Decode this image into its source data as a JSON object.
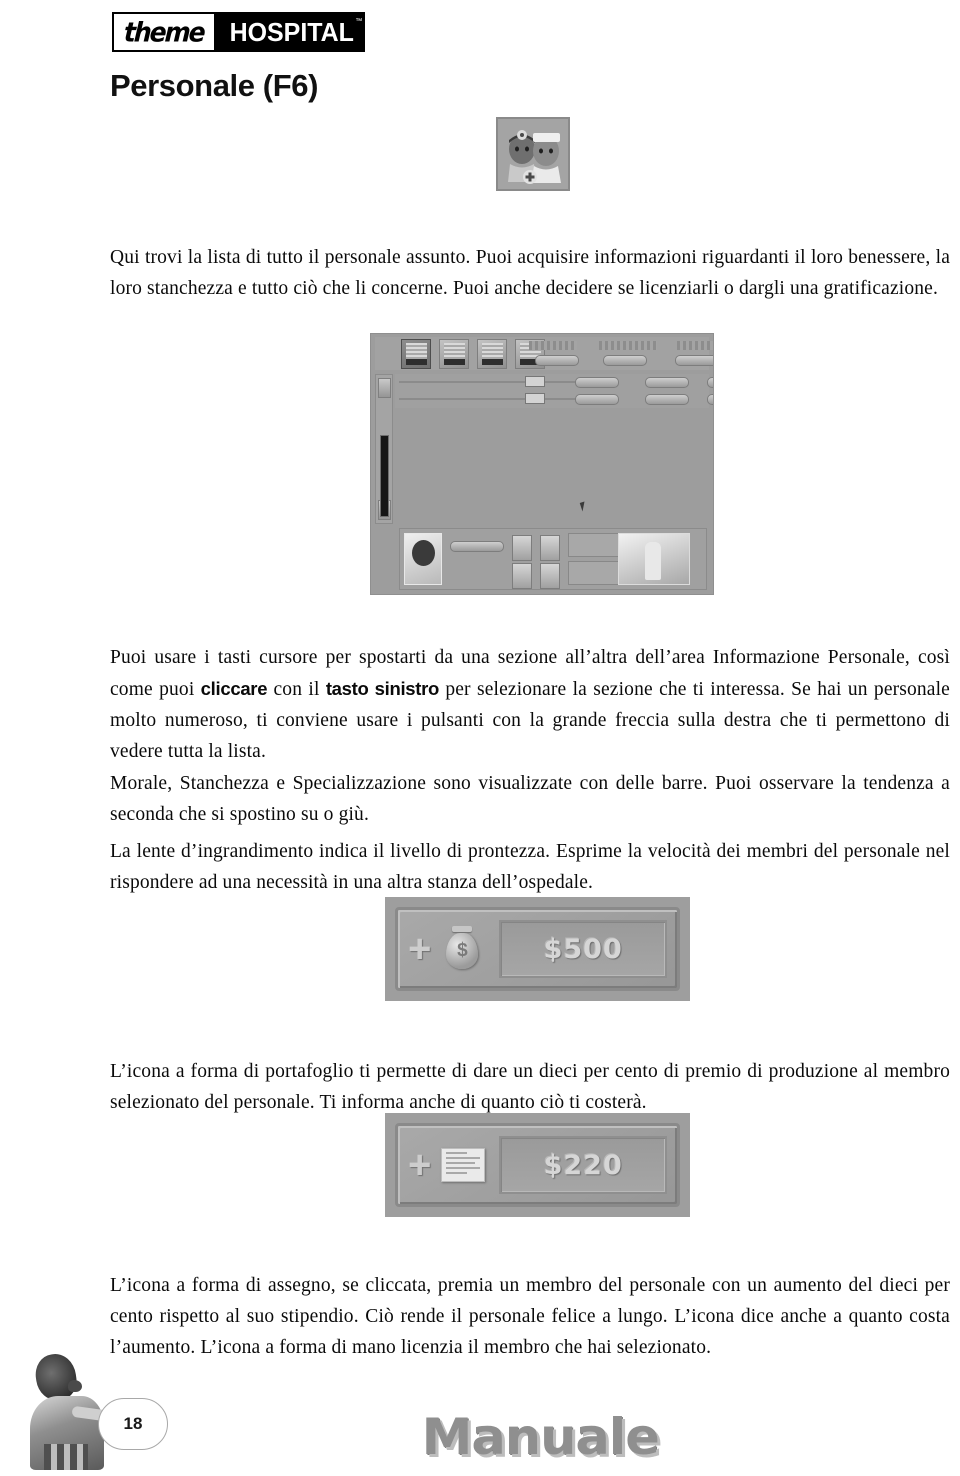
{
  "logo": {
    "word_left": "theme",
    "word_right": "HOSPITAL",
    "trademark": "™"
  },
  "page_title": "Personale (F6)",
  "icons": {
    "staff_icon": "doctor-and-nurse-icon",
    "money_bag_icon": "money-bag-icon",
    "cheque_icon": "cheque-icon",
    "plus_sign": "+"
  },
  "paragraphs": {
    "intro": "Qui trovi la lista di tutto il personale assunto. Puoi acquisire informazioni riguardanti il loro benessere, la loro stanchezza e tutto ciò che li concerne. Puoi anche decidere se licenziarli o dargli una gratificazione.",
    "nav_part1": "Puoi usare i tasti cursore per spostarti da una sezione all’altra dell’area Informazione Personale, così come puoi ",
    "nav_bold1": "cliccare",
    "nav_part2": " con il ",
    "nav_bold2": "tasto sinistro",
    "nav_part3": " per selezionare la sezione che ti interessa. Se hai un personale molto numeroso, ti conviene usare i pulsanti con la grande freccia sulla destra che ti permettono di vedere tutta la lista.",
    "bars": "Morale, Stanchezza e Specializzazione sono visualizzate con delle barre. Puoi osservare la tendenza a seconda che si spostino su o giù.",
    "lens": "La lente d’ingrandimento indica il livello di prontezza. Esprime la velocità dei membri del personale nel rispondere ad una necessità in una altra stanza dell’ospedale.",
    "wallet": "L’icona a forma di portafoglio ti permette di dare un dieci per cento di premio di produzione al membro selezionato del personale. Ti informa anche di quanto ciò ti costerà.",
    "cheque": "L’icona a forma di assegno, se cliccata, premia un membro del personale con un aumento del dieci per cento rispetto al suo stipendio. Ciò rende il personale felice a lungo. L’icona dice anche a quanto costa l’aumento. L’icona a forma di mano licenzia il membro che hai selezionato."
  },
  "buttons": {
    "bonus_amount": "$500",
    "raise_amount": "$220"
  },
  "footer": {
    "page_number": "18",
    "manual_label": "Manuale"
  },
  "colors": {
    "ink": "#0a0a0a",
    "logo_black": "#000000",
    "ui_gray": "#9e9e9e",
    "manual_gray": "#8f8f8f"
  }
}
